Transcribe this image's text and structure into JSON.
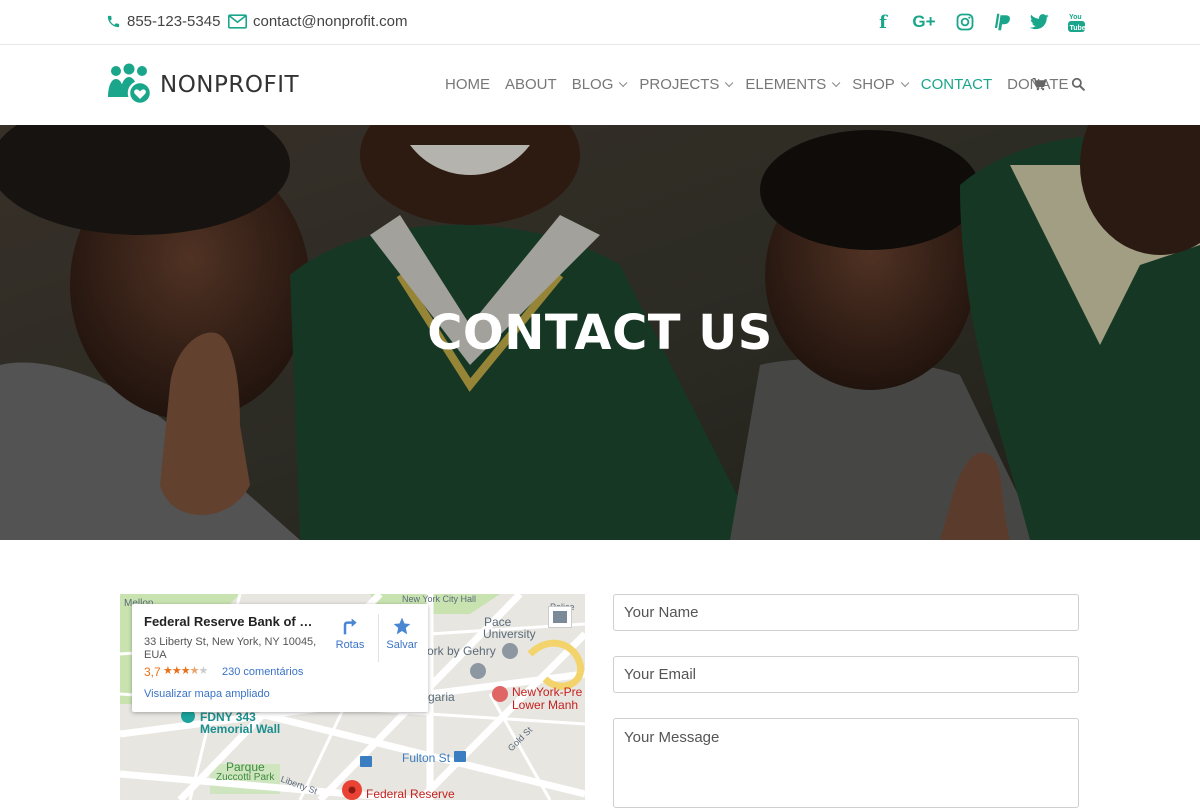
{
  "topbar": {
    "phone": "855-123-5345",
    "email": "contact@nonprofit.com",
    "social": [
      "facebook-icon",
      "google-plus-icon",
      "instagram-icon",
      "paypal-icon",
      "twitter-icon",
      "youtube-icon"
    ]
  },
  "brand": {
    "name": "NONPROFIT",
    "accent": "#1aa68a"
  },
  "nav": {
    "items": [
      {
        "label": "HOME",
        "dropdown": false
      },
      {
        "label": "ABOUT",
        "dropdown": false
      },
      {
        "label": "BLOG",
        "dropdown": true
      },
      {
        "label": "PROJECTS",
        "dropdown": true
      },
      {
        "label": "ELEMENTS",
        "dropdown": true
      },
      {
        "label": "SHOP",
        "dropdown": true
      },
      {
        "label": "CONTACT",
        "dropdown": false,
        "active": true
      },
      {
        "label": "DONATE",
        "dropdown": false
      }
    ]
  },
  "hero": {
    "title": "CONTACT US"
  },
  "map": {
    "place_name": "Federal Reserve Bank of New ...",
    "address_line1": "33 Liberty St, New York, NY 10045,",
    "address_line2": "EUA",
    "rating": "3,7",
    "stars": "★★★★★",
    "reviews": "230 comentários",
    "enlarge_link": "Visualizar mapa ampliado",
    "directions_label": "Rotas",
    "save_label": "Salvar",
    "labels": {
      "pace": "Pace",
      "university": "University",
      "gehry": "ork by Gehry",
      "hospital1": "NewYork-Pre",
      "hospital2": "Lower Manh",
      "fdny1": "FDNY 343",
      "fdny2": "Memorial Wall",
      "parque": "Parque",
      "zuccotti": "Zuccotti Park",
      "fulton": "Fulton St",
      "fed": "Federal Reserve",
      "garia": "garia",
      "mellon": "Mellon",
      "cityhall": "New York City Hall",
      "liberty": "Liberty St",
      "gold": "Gold St",
      "police": "Police"
    }
  },
  "form": {
    "name_placeholder": "Your Name",
    "email_placeholder": "Your Email",
    "message_placeholder": "Your Message"
  }
}
